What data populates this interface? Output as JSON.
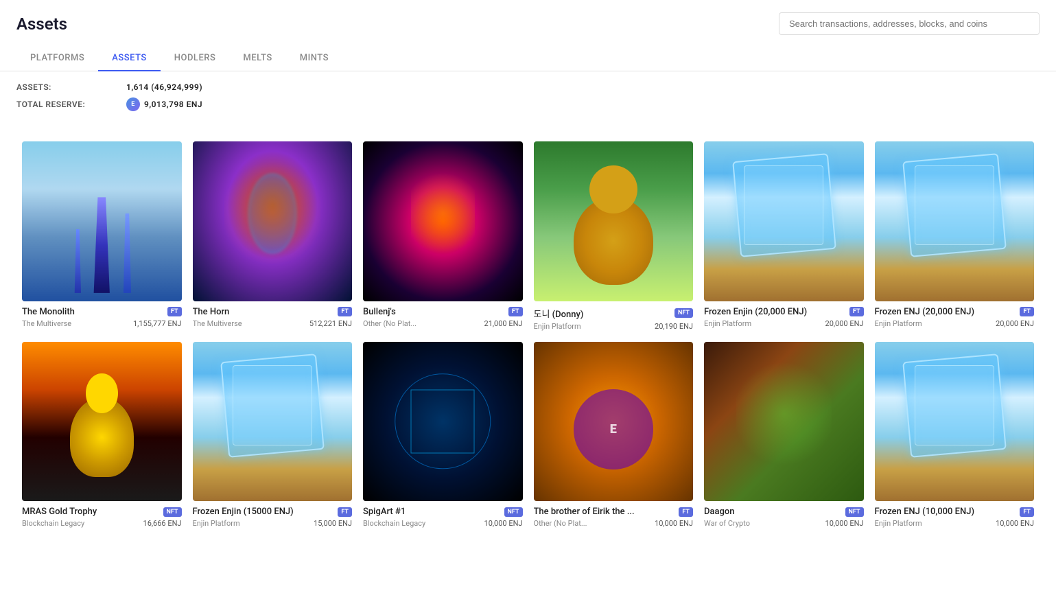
{
  "header": {
    "title": "Assets",
    "search_placeholder": "Search transactions, addresses, blocks, and coins"
  },
  "tabs": [
    {
      "id": "platforms",
      "label": "PLATFORMS",
      "active": false
    },
    {
      "id": "assets",
      "label": "ASSETS",
      "active": true
    },
    {
      "id": "hodlers",
      "label": "HODLERS",
      "active": false
    },
    {
      "id": "melts",
      "label": "MELTS",
      "active": false
    },
    {
      "id": "mints",
      "label": "MINTS",
      "active": false
    }
  ],
  "stats": {
    "assets_label": "ASSETS:",
    "assets_value": "1,614 (46,924,999)",
    "reserve_label": "TOTAL RESERVE:",
    "reserve_value": "9,013,798 ENJ",
    "enj_icon": "E"
  },
  "assets": [
    {
      "id": "monolith",
      "name": "The Monolith",
      "platform": "The Multiverse",
      "enj": "1,155,777 ENJ",
      "badge": "FT",
      "image_class": "img-monolith"
    },
    {
      "id": "horn",
      "name": "The Horn",
      "platform": "The Multiverse",
      "enj": "512,221 ENJ",
      "badge": "FT",
      "image_class": "img-horn"
    },
    {
      "id": "bullenj",
      "name": "Bullenj's",
      "platform": "Other (No Plat...",
      "enj": "21,000 ENJ",
      "badge": "FT",
      "image_class": "img-bullenj"
    },
    {
      "id": "donny",
      "name": "도니 (Donny)",
      "platform": "Enjin Platform",
      "enj": "20,190 ENJ",
      "badge": "NFT",
      "image_class": "img-donny"
    },
    {
      "id": "frozen20k-1",
      "name": "Frozen Enjin (20,000 ENJ)",
      "platform": "Enjin Platform",
      "enj": "20,000 ENJ",
      "badge": "FT",
      "image_class": "img-frozen1"
    },
    {
      "id": "frozen20k-2",
      "name": "Frozen ENJ (20,000 ENJ)",
      "platform": "Enjin Platform",
      "enj": "20,000 ENJ",
      "badge": "FT",
      "image_class": "img-frozen2"
    },
    {
      "id": "mras",
      "name": "MRAS Gold Trophy",
      "platform": "Blockchain Legacy",
      "enj": "16,666 ENJ",
      "badge": "NFT",
      "image_class": "img-mras"
    },
    {
      "id": "frozen15k",
      "name": "Frozen Enjin (15000 ENJ)",
      "platform": "Enjin Platform",
      "enj": "15,000 ENJ",
      "badge": "FT",
      "image_class": "img-frozen15"
    },
    {
      "id": "spigart",
      "name": "SpigArt #1",
      "platform": "Blockchain Legacy",
      "enj": "10,000 ENJ",
      "badge": "NFT",
      "image_class": "img-spigart"
    },
    {
      "id": "brother",
      "name": "The brother of Eirik the ...",
      "platform": "Other (No Plat...",
      "enj": "10,000 ENJ",
      "badge": "FT",
      "image_class": "img-brother"
    },
    {
      "id": "daagon",
      "name": "Daagon",
      "platform": "War of Crypto",
      "enj": "10,000 ENJ",
      "badge": "NFT",
      "image_class": "img-daagon"
    },
    {
      "id": "frozen10k",
      "name": "Frozen ENJ (10,000 ENJ)",
      "platform": "Enjin Platform",
      "enj": "10,000 ENJ",
      "badge": "FT",
      "image_class": "img-frozen10"
    }
  ]
}
